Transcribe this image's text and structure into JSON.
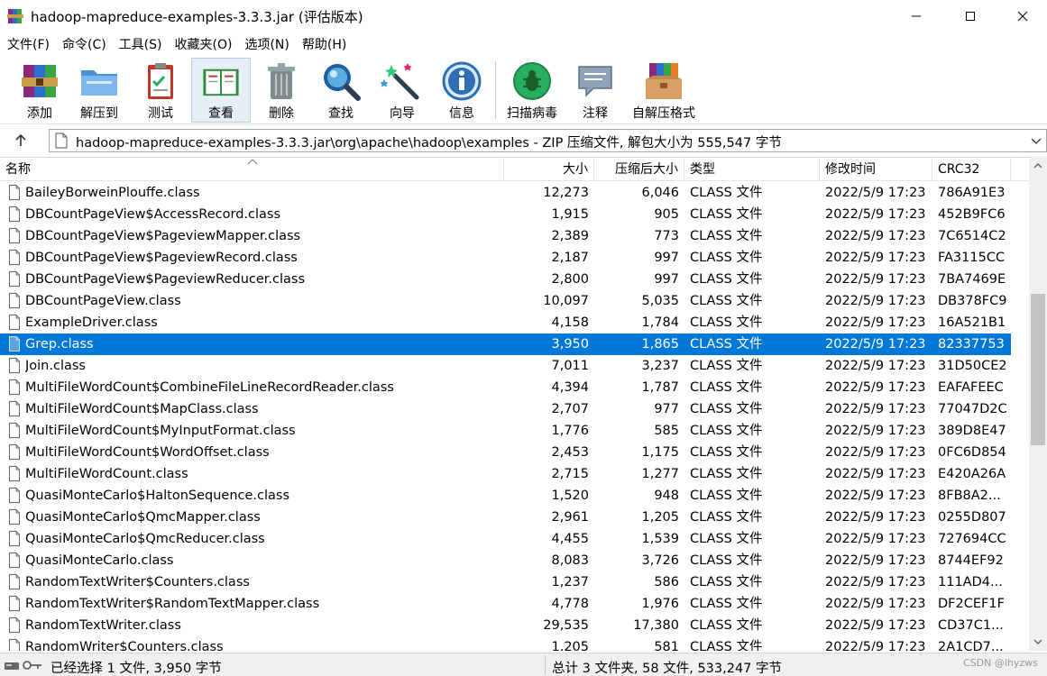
{
  "window": {
    "title": "hadoop-mapreduce-examples-3.3.3.jar (评估版本)"
  },
  "menu": [
    "文件(F)",
    "命令(C)",
    "工具(S)",
    "收藏夹(O)",
    "选项(N)",
    "帮助(H)"
  ],
  "toolbar": {
    "buttons": [
      {
        "label": "添加",
        "icon": "add-archive-icon"
      },
      {
        "label": "解压到",
        "icon": "extract-folder-icon"
      },
      {
        "label": "测试",
        "icon": "test-clipboard-icon"
      },
      {
        "label": "查看",
        "icon": "view-book-icon",
        "active": true
      },
      {
        "label": "删除",
        "icon": "trash-icon"
      },
      {
        "label": "查找",
        "icon": "magnifier-icon"
      },
      {
        "label": "向导",
        "icon": "wizard-wand-icon"
      },
      {
        "label": "信息",
        "icon": "info-icon"
      },
      {
        "label": "扫描病毒",
        "icon": "virus-scan-icon"
      },
      {
        "label": "注释",
        "icon": "comment-icon"
      },
      {
        "label": "自解压格式",
        "icon": "sfx-box-icon"
      }
    ]
  },
  "address": {
    "path": "hadoop-mapreduce-examples-3.3.3.jar\\org\\apache\\hadoop\\examples - ZIP 压缩文件, 解包大小为 555,547 字节"
  },
  "columns": {
    "name": "名称",
    "size": "大小",
    "compressed": "压缩后大小",
    "type": "类型",
    "modified": "修改时间",
    "crc": "CRC32"
  },
  "files": [
    {
      "name": "BaileyBorweinPlouffe.class",
      "size": "12,273",
      "packed": "6,046",
      "type": "CLASS 文件",
      "modified": "2022/5/9 17:23",
      "crc": "786A91E3"
    },
    {
      "name": "DBCountPageView$AccessRecord.class",
      "size": "1,915",
      "packed": "905",
      "type": "CLASS 文件",
      "modified": "2022/5/9 17:23",
      "crc": "452B9FC6"
    },
    {
      "name": "DBCountPageView$PageviewMapper.class",
      "size": "2,389",
      "packed": "773",
      "type": "CLASS 文件",
      "modified": "2022/5/9 17:23",
      "crc": "7C6514C2"
    },
    {
      "name": "DBCountPageView$PageviewRecord.class",
      "size": "2,187",
      "packed": "997",
      "type": "CLASS 文件",
      "modified": "2022/5/9 17:23",
      "crc": "FA3115CC"
    },
    {
      "name": "DBCountPageView$PageviewReducer.class",
      "size": "2,800",
      "packed": "997",
      "type": "CLASS 文件",
      "modified": "2022/5/9 17:23",
      "crc": "7BA7469E"
    },
    {
      "name": "DBCountPageView.class",
      "size": "10,097",
      "packed": "5,035",
      "type": "CLASS 文件",
      "modified": "2022/5/9 17:23",
      "crc": "DB378FC9"
    },
    {
      "name": "ExampleDriver.class",
      "size": "4,158",
      "packed": "1,784",
      "type": "CLASS 文件",
      "modified": "2022/5/9 17:23",
      "crc": "16A521B1"
    },
    {
      "name": "Grep.class",
      "size": "3,950",
      "packed": "1,865",
      "type": "CLASS 文件",
      "modified": "2022/5/9 17:23",
      "crc": "82337753",
      "selected": true
    },
    {
      "name": "Join.class",
      "size": "7,011",
      "packed": "3,237",
      "type": "CLASS 文件",
      "modified": "2022/5/9 17:23",
      "crc": "31D50CE2"
    },
    {
      "name": "MultiFileWordCount$CombineFileLineRecordReader.class",
      "size": "4,394",
      "packed": "1,787",
      "type": "CLASS 文件",
      "modified": "2022/5/9 17:23",
      "crc": "EAFAFEEC"
    },
    {
      "name": "MultiFileWordCount$MapClass.class",
      "size": "2,707",
      "packed": "977",
      "type": "CLASS 文件",
      "modified": "2022/5/9 17:23",
      "crc": "77047D2C"
    },
    {
      "name": "MultiFileWordCount$MyInputFormat.class",
      "size": "1,776",
      "packed": "585",
      "type": "CLASS 文件",
      "modified": "2022/5/9 17:23",
      "crc": "389D8E47"
    },
    {
      "name": "MultiFileWordCount$WordOffset.class",
      "size": "2,453",
      "packed": "1,175",
      "type": "CLASS 文件",
      "modified": "2022/5/9 17:23",
      "crc": "0FC6D854"
    },
    {
      "name": "MultiFileWordCount.class",
      "size": "2,715",
      "packed": "1,277",
      "type": "CLASS 文件",
      "modified": "2022/5/9 17:23",
      "crc": "E420A26A"
    },
    {
      "name": "QuasiMonteCarlo$HaltonSequence.class",
      "size": "1,520",
      "packed": "948",
      "type": "CLASS 文件",
      "modified": "2022/5/9 17:23",
      "crc": "8FB8A2..."
    },
    {
      "name": "QuasiMonteCarlo$QmcMapper.class",
      "size": "2,961",
      "packed": "1,205",
      "type": "CLASS 文件",
      "modified": "2022/5/9 17:23",
      "crc": "0255D807"
    },
    {
      "name": "QuasiMonteCarlo$QmcReducer.class",
      "size": "4,455",
      "packed": "1,539",
      "type": "CLASS 文件",
      "modified": "2022/5/9 17:23",
      "crc": "727694CC"
    },
    {
      "name": "QuasiMonteCarlo.class",
      "size": "8,083",
      "packed": "3,726",
      "type": "CLASS 文件",
      "modified": "2022/5/9 17:23",
      "crc": "8744EF92"
    },
    {
      "name": "RandomTextWriter$Counters.class",
      "size": "1,237",
      "packed": "586",
      "type": "CLASS 文件",
      "modified": "2022/5/9 17:23",
      "crc": "111AD4..."
    },
    {
      "name": "RandomTextWriter$RandomTextMapper.class",
      "size": "4,778",
      "packed": "1,976",
      "type": "CLASS 文件",
      "modified": "2022/5/9 17:23",
      "crc": "DF2CEF1F"
    },
    {
      "name": "RandomTextWriter.class",
      "size": "29,535",
      "packed": "17,380",
      "type": "CLASS 文件",
      "modified": "2022/5/9 17:23",
      "crc": "CD37C1..."
    },
    {
      "name": "RandomWriter$Counters.class",
      "size": "1,205",
      "packed": "581",
      "type": "CLASS 文件",
      "modified": "2022/5/9 17:23",
      "crc": "2A1CD7..."
    }
  ],
  "status": {
    "selected": "已经选择 1 文件, 3,950 字节",
    "total": "总计 3 文件夹, 58 文件, 533,247 字节",
    "watermark": "CSDN @lhyzws"
  },
  "colors": {
    "selection": "#0078d7",
    "statusbar": "#f0f0f0"
  }
}
